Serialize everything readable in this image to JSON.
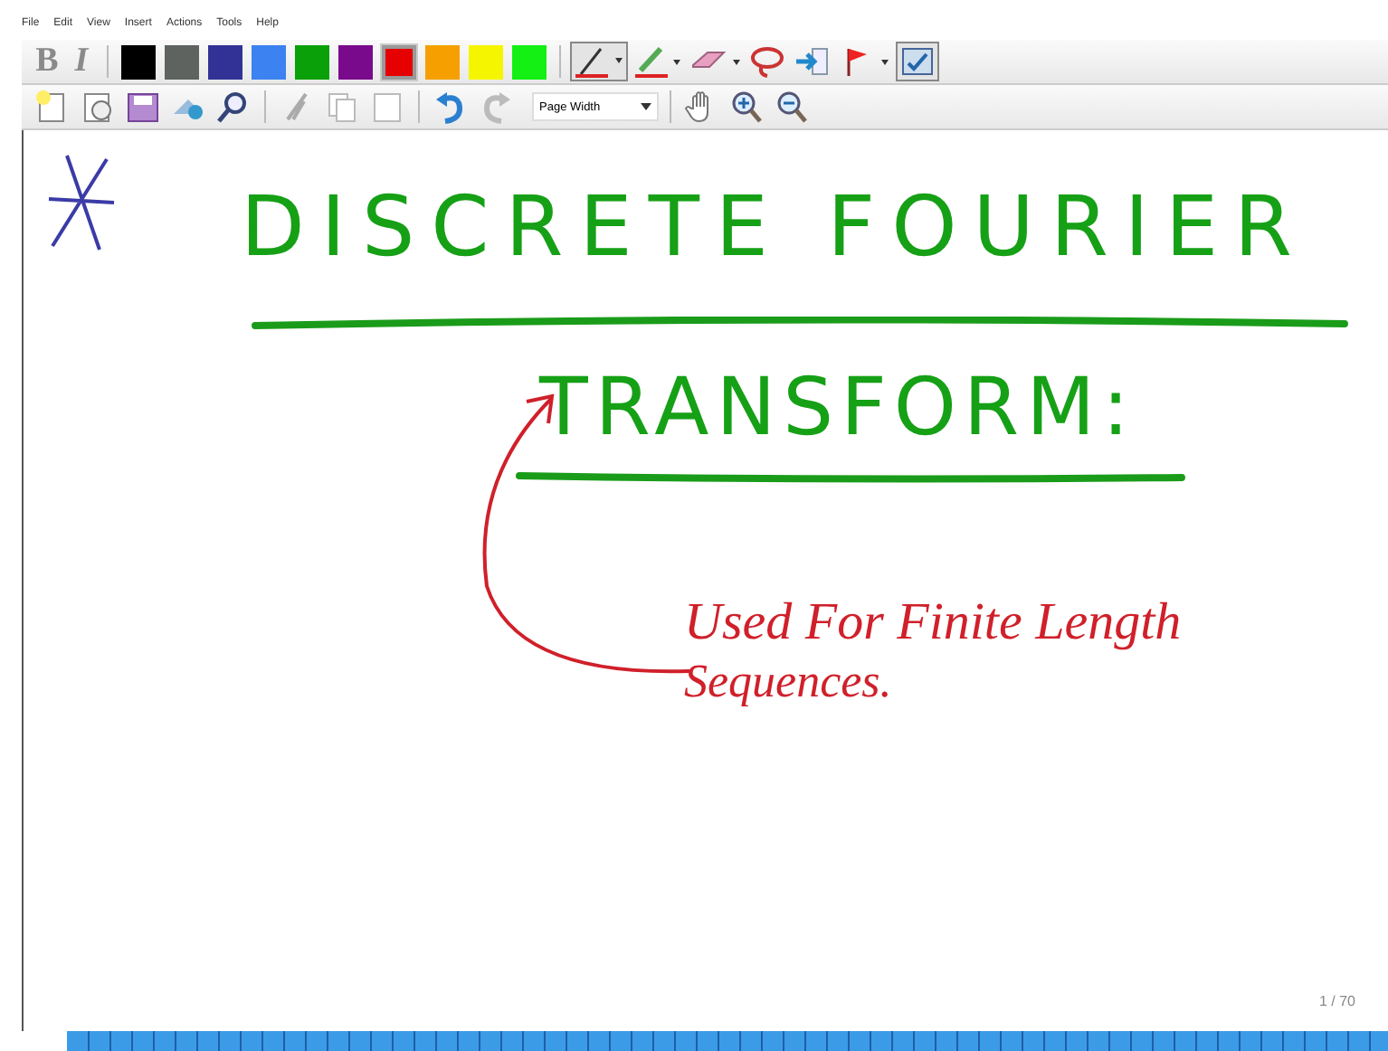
{
  "menu": [
    "File",
    "Edit",
    "View",
    "Insert",
    "Actions",
    "Tools",
    "Help"
  ],
  "format_buttons": [
    {
      "label": "B",
      "kind": "bold",
      "disabled": true
    },
    {
      "label": "I",
      "kind": "italic",
      "disabled": true
    }
  ],
  "swatches": [
    {
      "color": "#000000",
      "selected": false
    },
    {
      "color": "#5f635f",
      "selected": false
    },
    {
      "color": "#323296",
      "selected": false
    },
    {
      "color": "#3c82f0",
      "selected": false
    },
    {
      "color": "#0aa00a",
      "selected": false
    },
    {
      "color": "#7a0a8c",
      "selected": false
    },
    {
      "color": "#e60000",
      "selected": true
    },
    {
      "color": "#f5a000",
      "selected": false
    },
    {
      "color": "#f5f500",
      "selected": false
    },
    {
      "color": "#14f014",
      "selected": false
    }
  ],
  "zoom_select": {
    "value": "Page Width"
  },
  "page": {
    "title_line_1": "DISCRETE FOURIER",
    "title_line_2": "TRANSFORM:",
    "note_line_1": "Used For Finite Length",
    "note_line_2": "Sequences.",
    "page_counter": "1 / 70"
  }
}
